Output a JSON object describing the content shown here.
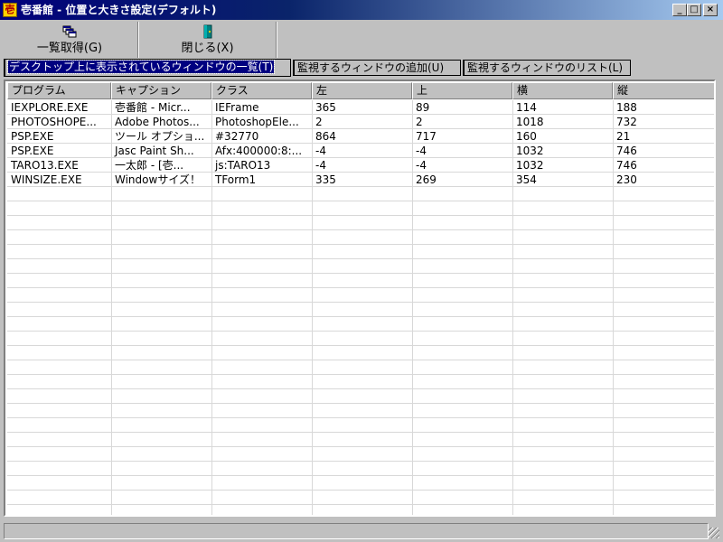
{
  "window": {
    "title": "壱番館 - 位置と大きさ設定(デフォルト)",
    "app_icon_glyph": "壱",
    "minimize_glyph": "_",
    "maximize_glyph": "□",
    "close_glyph": "×"
  },
  "toolbar": {
    "get_list_label": "一覧取得(G)",
    "close_label": "閉じる(X)"
  },
  "tabs": [
    {
      "label": "デスクトップ上に表示されているウィンドウの一覧(T)",
      "active": true
    },
    {
      "label": "監視するウィンドウの追加(U)",
      "active": false
    },
    {
      "label": "監視するウィンドウのリスト(L)",
      "active": false
    }
  ],
  "table": {
    "columns": [
      "プログラム",
      "キャプション",
      "クラス",
      "左",
      "上",
      "横",
      "縦"
    ],
    "rows": [
      [
        "IEXPLORE.EXE",
        "壱番館 - Micr...",
        "IEFrame",
        "365",
        "89",
        "114",
        "188"
      ],
      [
        "PHOTOSHOPE...",
        "Adobe Photos...",
        "PhotoshopEle...",
        "2",
        "2",
        "1018",
        "732"
      ],
      [
        "PSP.EXE",
        "ツール オプショ...",
        "#32770",
        "864",
        "717",
        "160",
        "21"
      ],
      [
        "PSP.EXE",
        "Jasc Paint Sh...",
        "Afx:400000:8:...",
        "-4",
        "-4",
        "1032",
        "746"
      ],
      [
        "TARO13.EXE",
        "一太郎 - [壱...",
        "js:TARO13",
        "-4",
        "-4",
        "1032",
        "746"
      ],
      [
        "WINSIZE.EXE",
        "Windowサイズ！",
        "TForm1",
        "335",
        "269",
        "354",
        "230"
      ]
    ]
  },
  "status": {
    "text": ""
  }
}
